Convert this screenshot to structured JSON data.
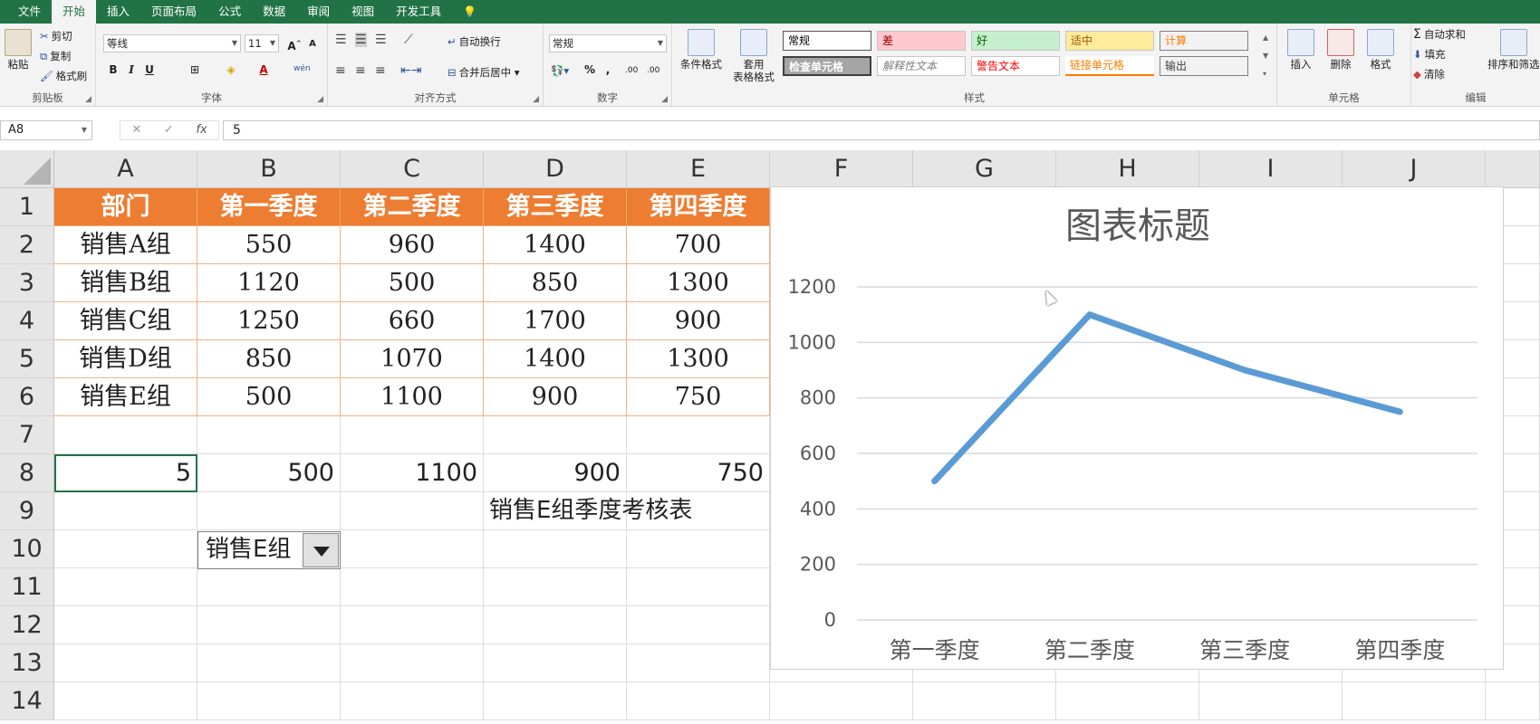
{
  "ribbon_tabs": [
    "文件",
    "开始",
    "插入",
    "页面布局",
    "公式",
    "数据",
    "审阅",
    "视图",
    "开发工具"
  ],
  "active_tab": 1,
  "clipboard": {
    "paste": "粘贴",
    "cut": "剪切",
    "copy": "复制",
    "format_painter": "格式刷",
    "label": "剪贴板"
  },
  "font": {
    "name": "等线",
    "size": "11",
    "bold": "B",
    "italic": "I",
    "underline": "U",
    "grow": "A",
    "shrink": "A",
    "font_color": "A",
    "phonetic": "wén",
    "label": "字体"
  },
  "alignment": {
    "wrap": "自动换行",
    "merge": "合并后居中",
    "label": "对齐方式"
  },
  "number": {
    "format": "常规",
    "percent": "%",
    "comma": ",",
    "inc_decimal": ".00",
    "dec_decimal": ".00",
    "label": "数字"
  },
  "styles": {
    "conditional": "条件格式",
    "table_format_1": "套用",
    "table_format_2": "表格格式",
    "label": "样式",
    "cells": [
      {
        "name": "常规",
        "bg": "#ffffff",
        "color": "#000000"
      },
      {
        "name": "差",
        "bg": "#ffc7ce",
        "color": "#9c0006"
      },
      {
        "name": "好",
        "bg": "#c6efce",
        "color": "#006100"
      },
      {
        "name": "适中",
        "bg": "#ffeb9c",
        "color": "#9c5700"
      },
      {
        "name": "计算",
        "bg": "#f2f2f2",
        "color": "#fa7d00"
      },
      {
        "name": "检查单元格",
        "bg": "#a5a5a5",
        "color": "#ffffff"
      },
      {
        "name": "解释性文本",
        "bg": "#ffffff",
        "color": "#7f7f7f"
      },
      {
        "name": "警告文本",
        "bg": "#ffffff",
        "color": "#ff0000"
      },
      {
        "name": "链接单元格",
        "bg": "#ffffff",
        "color": "#fa7d00"
      },
      {
        "name": "输出",
        "bg": "#f2f2f2",
        "color": "#3f3f3f"
      }
    ]
  },
  "cells_group": {
    "insert": "插入",
    "delete": "删除",
    "format": "格式",
    "label": "单元格"
  },
  "editing": {
    "autosum": "自动求和",
    "fill": "填充",
    "clear": "清除",
    "sort": "排序和筛选",
    "label": "编辑"
  },
  "formula_bar": {
    "name_box": "A8",
    "formula": "5"
  },
  "columns": [
    "A",
    "B",
    "C",
    "D",
    "E",
    "F",
    "G",
    "H",
    "I",
    "J"
  ],
  "rows": [
    "1",
    "2",
    "3",
    "4",
    "5",
    "6",
    "7",
    "8",
    "9",
    "10",
    "11",
    "12",
    "13",
    "14"
  ],
  "table": {
    "header": [
      "部门",
      "第一季度",
      "第二季度",
      "第三季度",
      "第四季度"
    ],
    "rows": [
      [
        "销售A组",
        "550",
        "960",
        "1400",
        "700"
      ],
      [
        "销售B组",
        "1120",
        "500",
        "850",
        "1300"
      ],
      [
        "销售C组",
        "1250",
        "660",
        "1700",
        "900"
      ],
      [
        "销售D组",
        "850",
        "1070",
        "1400",
        "1300"
      ],
      [
        "销售E组",
        "500",
        "1100",
        "900",
        "750"
      ]
    ]
  },
  "row8": [
    "5",
    "500",
    "1100",
    "900",
    "750"
  ],
  "d9": "销售E组季度考核表",
  "dropdown": {
    "value": "销售E组"
  },
  "accent": "#217346",
  "header_fill": "#ed7d31",
  "chart_data": {
    "type": "line",
    "title": "图表标题",
    "categories": [
      "第一季度",
      "第二季度",
      "第三季度",
      "第四季度"
    ],
    "series": [
      {
        "values": [
          500,
          1100,
          900,
          750
        ],
        "color": "#5b9bd5"
      }
    ],
    "ylim": [
      0,
      1200
    ],
    "yticks": [
      "0",
      "200",
      "400",
      "600",
      "800",
      "1000",
      "1200"
    ],
    "grid": true
  }
}
